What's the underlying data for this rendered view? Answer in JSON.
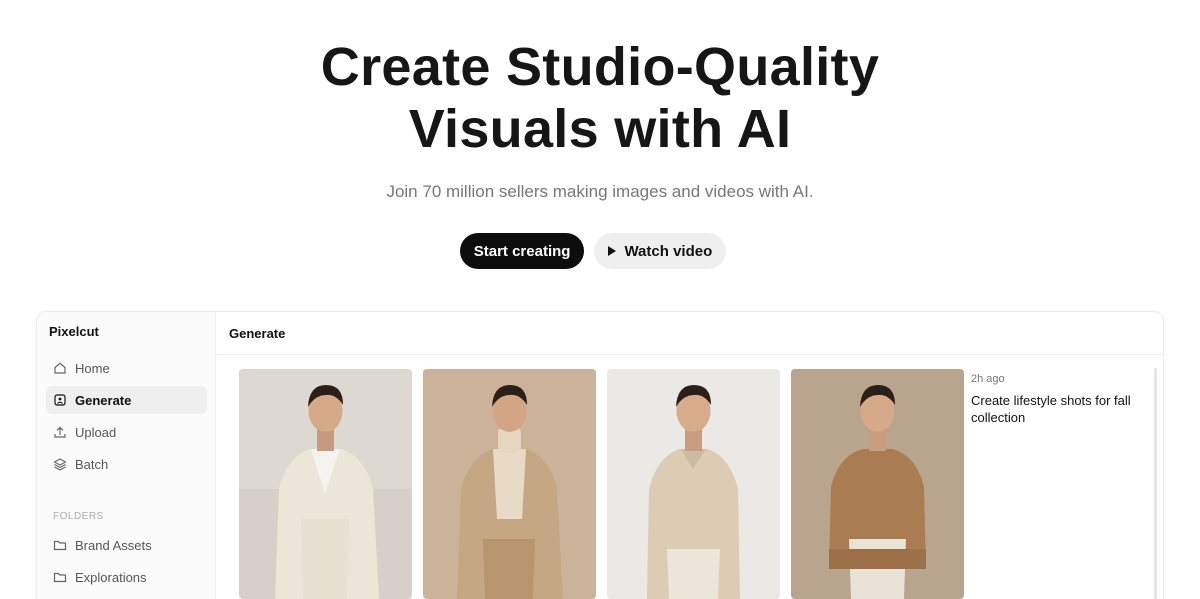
{
  "hero": {
    "title_line1": "Create Studio-Quality",
    "title_line2": "Visuals with AI",
    "subtitle": "Join 70 million sellers making images and videos with AI.",
    "primary_cta": "Start creating",
    "secondary_cta": "Watch video"
  },
  "app": {
    "brand": "Pixelcut",
    "header_title": "Generate",
    "sidebar": {
      "items": [
        {
          "label": "Home",
          "icon": "home-icon",
          "active": false
        },
        {
          "label": "Generate",
          "icon": "image-icon",
          "active": true
        },
        {
          "label": "Upload",
          "icon": "upload-icon",
          "active": false
        },
        {
          "label": "Batch",
          "icon": "layers-icon",
          "active": false
        }
      ],
      "folders_label": "FOLDERS",
      "folders": [
        {
          "label": "Brand Assets",
          "icon": "folder-icon"
        },
        {
          "label": "Explorations",
          "icon": "folder-icon"
        }
      ]
    },
    "gallery": {
      "images": [
        {
          "name": "model-cream-suit",
          "outfit": "cream suit with white shirt"
        },
        {
          "name": "model-tan-blazer-turtleneck",
          "outfit": "tan blazer with turtleneck"
        },
        {
          "name": "model-linen-shirt",
          "outfit": "beige linen shirt"
        },
        {
          "name": "model-knit-sweater",
          "outfit": "brown knit sweater"
        }
      ],
      "time": "2h ago",
      "prompt": "Create lifestyle shots for fall collection"
    }
  },
  "colors": {
    "primary_button": "#0d0d0d",
    "secondary_button": "#efefef",
    "active_nav": "#efefef"
  }
}
